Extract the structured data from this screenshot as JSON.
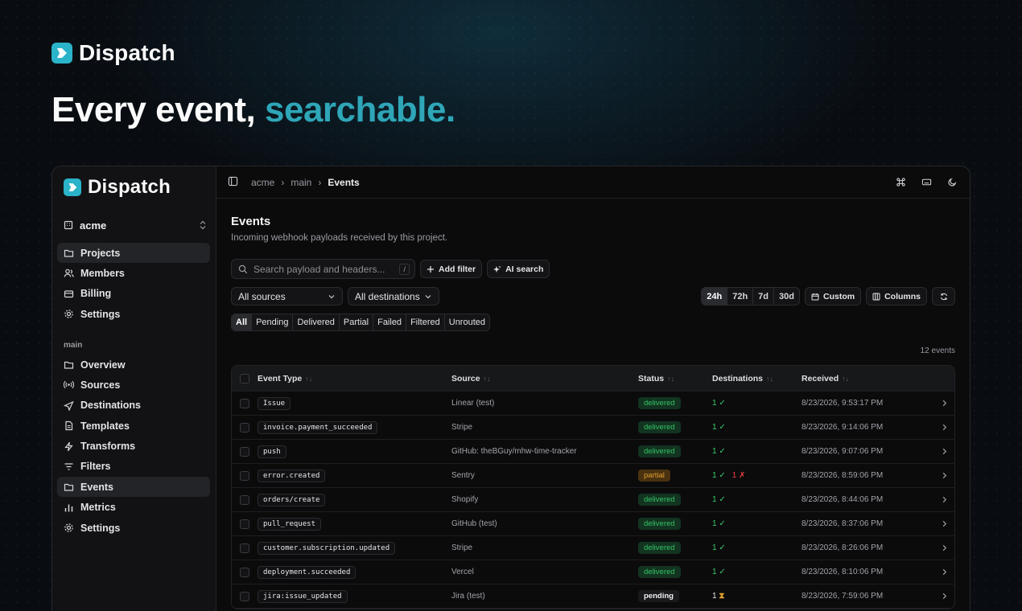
{
  "brand": {
    "name": "Dispatch",
    "color": "#2ab3c9"
  },
  "hero": {
    "title_plain": "Every event,",
    "title_accent": "searchable."
  },
  "sidebar": {
    "org": "acme",
    "org_items": [
      {
        "label": "Projects",
        "icon": "folder-icon",
        "active": true
      },
      {
        "label": "Members",
        "icon": "users-icon",
        "active": false
      },
      {
        "label": "Billing",
        "icon": "credit-card-icon",
        "active": false
      },
      {
        "label": "Settings",
        "icon": "gear-icon",
        "active": false
      }
    ],
    "section_label": "main",
    "project_items": [
      {
        "label": "Overview",
        "icon": "folder-icon",
        "active": false
      },
      {
        "label": "Sources",
        "icon": "radio-icon",
        "active": false
      },
      {
        "label": "Destinations",
        "icon": "send-icon",
        "active": false
      },
      {
        "label": "Templates",
        "icon": "file-icon",
        "active": false
      },
      {
        "label": "Transforms",
        "icon": "bolt-icon",
        "active": false
      },
      {
        "label": "Filters",
        "icon": "filter-icon",
        "active": false
      },
      {
        "label": "Events",
        "icon": "list-icon",
        "active": true
      },
      {
        "label": "Metrics",
        "icon": "bar-chart-icon",
        "active": false
      },
      {
        "label": "Settings",
        "icon": "gear-icon",
        "active": false
      }
    ]
  },
  "topbar": {
    "breadcrumb": [
      "acme",
      "main",
      "Events"
    ]
  },
  "page": {
    "title": "Events",
    "subtitle": "Incoming webhook payloads received by this project."
  },
  "search": {
    "placeholder": "Search payload and headers...",
    "shortcut": "/"
  },
  "buttons": {
    "add_filter": "Add filter",
    "ai_search": "AI search",
    "custom": "Custom",
    "columns": "Columns"
  },
  "filters": {
    "sources": "All sources",
    "destinations": "All destinations"
  },
  "ranges": [
    {
      "label": "24h",
      "active": true
    },
    {
      "label": "72h",
      "active": false
    },
    {
      "label": "7d",
      "active": false
    },
    {
      "label": "30d",
      "active": false
    }
  ],
  "status_tabs": [
    {
      "label": "All",
      "active": true
    },
    {
      "label": "Pending",
      "active": false
    },
    {
      "label": "Delivered",
      "active": false
    },
    {
      "label": "Partial",
      "active": false
    },
    {
      "label": "Failed",
      "active": false
    },
    {
      "label": "Filtered",
      "active": false
    },
    {
      "label": "Unrouted",
      "active": false
    }
  ],
  "event_count": "12 events",
  "table": {
    "headers": [
      "Event Type",
      "Source",
      "Status",
      "Destinations",
      "Received"
    ],
    "rows": [
      {
        "type": "Issue",
        "source": "Linear (test)",
        "status": "delivered",
        "ok": "1",
        "fail": "",
        "pending": "",
        "received": "8/23/2026, 9:53:17 PM"
      },
      {
        "type": "invoice.payment_succeeded",
        "source": "Stripe",
        "status": "delivered",
        "ok": "1",
        "fail": "",
        "pending": "",
        "received": "8/23/2026, 9:14:06 PM"
      },
      {
        "type": "push",
        "source": "GitHub: theBGuy/mhw-time-tracker",
        "status": "delivered",
        "ok": "1",
        "fail": "",
        "pending": "",
        "received": "8/23/2026, 9:07:06 PM"
      },
      {
        "type": "error.created",
        "source": "Sentry",
        "status": "partial",
        "ok": "1",
        "fail": "1",
        "pending": "",
        "received": "8/23/2026, 8:59:06 PM"
      },
      {
        "type": "orders/create",
        "source": "Shopify",
        "status": "delivered",
        "ok": "1",
        "fail": "",
        "pending": "",
        "received": "8/23/2026, 8:44:06 PM"
      },
      {
        "type": "pull_request",
        "source": "GitHub (test)",
        "status": "delivered",
        "ok": "1",
        "fail": "",
        "pending": "",
        "received": "8/23/2026, 8:37:06 PM"
      },
      {
        "type": "customer.subscription.updated",
        "source": "Stripe",
        "status": "delivered",
        "ok": "1",
        "fail": "",
        "pending": "",
        "received": "8/23/2026, 8:26:06 PM"
      },
      {
        "type": "deployment.succeeded",
        "source": "Vercel",
        "status": "delivered",
        "ok": "1",
        "fail": "",
        "pending": "",
        "received": "8/23/2026, 8:10:06 PM"
      },
      {
        "type": "jira:issue_updated",
        "source": "Jira (test)",
        "status": "pending",
        "ok": "",
        "fail": "",
        "pending": "1",
        "received": "8/23/2026, 7:59:06 PM"
      }
    ]
  }
}
